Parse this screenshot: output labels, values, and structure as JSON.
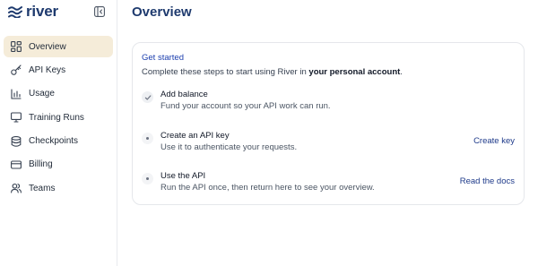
{
  "brand": {
    "name": "river",
    "color": "#1e3a6e"
  },
  "sidebar": {
    "items": [
      {
        "label": "Overview",
        "icon": "grid-icon",
        "active": true
      },
      {
        "label": "API Keys",
        "icon": "key-icon",
        "active": false
      },
      {
        "label": "Usage",
        "icon": "bar-chart-icon",
        "active": false
      },
      {
        "label": "Training Runs",
        "icon": "monitor-icon",
        "active": false
      },
      {
        "label": "Checkpoints",
        "icon": "database-icon",
        "active": false
      },
      {
        "label": "Billing",
        "icon": "credit-card-icon",
        "active": false
      },
      {
        "label": "Teams",
        "icon": "users-icon",
        "active": false
      }
    ],
    "active_color": "#f5ecd9"
  },
  "page": {
    "title": "Overview"
  },
  "getting_started": {
    "heading": "Get started",
    "subtitle_prefix": "Complete these steps to start using River in ",
    "subtitle_bold": "your personal account",
    "subtitle_suffix": ".",
    "steps": [
      {
        "title": "Add balance",
        "description": "Fund your account so your API work can run.",
        "status": "done",
        "action": ""
      },
      {
        "title": "Create an API key",
        "description": "Use it to authenticate your requests.",
        "status": "pending",
        "action": "Create key"
      },
      {
        "title": "Use the API",
        "description": "Run the API once, then return here to see your overview.",
        "status": "pending",
        "action": "Read the docs"
      }
    ]
  }
}
